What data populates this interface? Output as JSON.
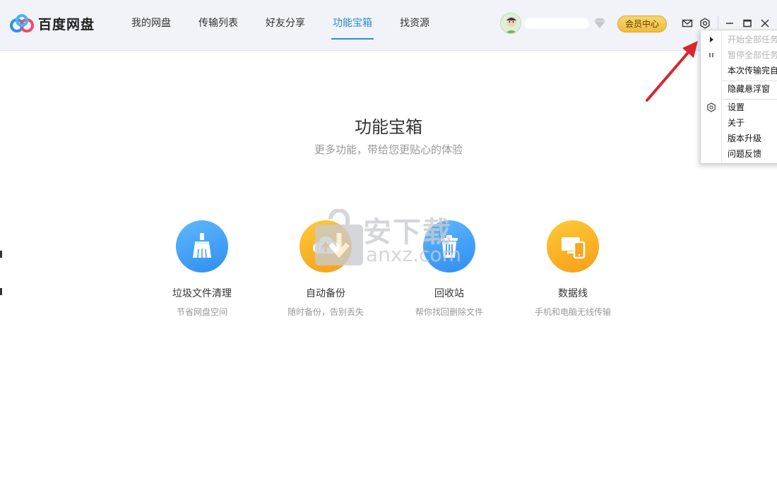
{
  "app": {
    "logo_text": "百度网盘"
  },
  "nav": {
    "items": [
      {
        "label": "我的网盘",
        "active": false
      },
      {
        "label": "传输列表",
        "active": false
      },
      {
        "label": "好友分享",
        "active": false
      },
      {
        "label": "功能宝箱",
        "active": true
      },
      {
        "label": "找资源",
        "active": false
      }
    ]
  },
  "header": {
    "vip_label": "会员中心",
    "icons": [
      "mail-icon",
      "settings-gear-icon",
      "minimize-icon",
      "maximize-icon",
      "close-icon"
    ]
  },
  "main": {
    "title": "功能宝箱",
    "subtitle": "更多功能，带给您更贴心的体验",
    "tools": [
      {
        "name": "垃圾文件清理",
        "desc": "节省网盘空间",
        "icon": "broom-icon",
        "color": "#3f9ff5"
      },
      {
        "name": "自动备份",
        "desc": "随时备份，告别丢失",
        "icon": "cloud-upload-icon",
        "color": "#f8b22a"
      },
      {
        "name": "回收站",
        "desc": "帮你找回删除文件",
        "icon": "recycle-bin-icon",
        "color": "#3f9ff5"
      },
      {
        "name": "数据线",
        "desc": "手机和电脑无线传输",
        "icon": "phone-pc-icon",
        "color": "#f8b22a"
      }
    ]
  },
  "watermark": {
    "text": "安下载",
    "sub": "anxz.com"
  },
  "settings_menu": {
    "items": [
      {
        "label": "开始全部任务",
        "disabled": true,
        "icon": "play-icon"
      },
      {
        "label": "暂停全部任务",
        "disabled": true,
        "icon": "pause-icon"
      },
      {
        "label": "本次传输完自动关机",
        "disabled": false,
        "icon": ""
      },
      {
        "label": "隐藏悬浮窗",
        "disabled": false,
        "icon": ""
      },
      {
        "label": "设置",
        "disabled": false,
        "icon": "gear-icon"
      },
      {
        "label": "关于",
        "disabled": false,
        "icon": ""
      },
      {
        "label": "版本升级",
        "disabled": false,
        "icon": ""
      },
      {
        "label": "问题反馈",
        "disabled": false,
        "icon": ""
      }
    ]
  },
  "colors": {
    "accent": "#2a8ed6",
    "vip_gold": "#f0bd3e",
    "annotation_red": "#d9252b"
  }
}
